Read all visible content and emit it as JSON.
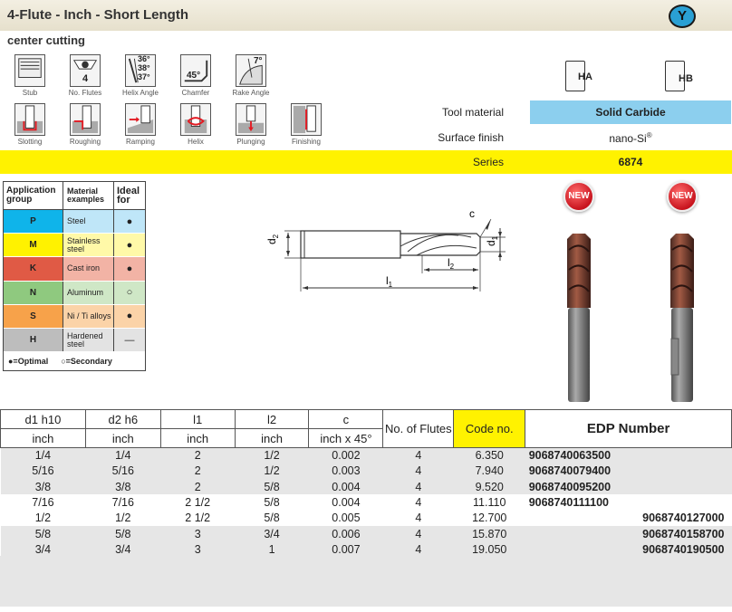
{
  "header": {
    "title": "4-Flute - Inch - Short Length",
    "coating_badge": "Y",
    "subtitle": "center cutting"
  },
  "feature_icons": {
    "row1": [
      {
        "label": "Stub",
        "icon": "stub-icon"
      },
      {
        "label": "No. Flutes",
        "icon": "flutes-icon",
        "value": "4"
      },
      {
        "label": "Helix Angle",
        "icon": "helix-angle-icon",
        "values": [
          "36°",
          "38°",
          "37°"
        ]
      },
      {
        "label": "Chamfer",
        "icon": "chamfer-icon",
        "value": "45°"
      },
      {
        "label": "Rake Angle",
        "icon": "rake-angle-icon",
        "value": "7°"
      }
    ],
    "row2": [
      {
        "label": "Slotting",
        "icon": "slotting-icon"
      },
      {
        "label": "Roughing",
        "icon": "roughing-icon"
      },
      {
        "label": "Ramping",
        "icon": "ramping-icon"
      },
      {
        "label": "Helix",
        "icon": "helix-icon"
      },
      {
        "label": "Plunging",
        "icon": "plunging-icon"
      },
      {
        "label": "Finishing",
        "icon": "finishing-icon"
      }
    ]
  },
  "shank_types": [
    {
      "label": "HA"
    },
    {
      "label": "HB"
    }
  ],
  "properties": {
    "tool_material_label": "Tool material",
    "tool_material_value": "Solid Carbide",
    "surface_finish_label": "Surface finish",
    "surface_finish_value": "nano-Si",
    "surface_finish_mark": "®",
    "series_label": "Series",
    "series_value": "6874"
  },
  "application_table": {
    "headers": [
      "Application group",
      "Material examples",
      "Ideal for"
    ],
    "rows": [
      {
        "group": "P",
        "material": "Steel",
        "ideal": "●",
        "color": "#0fb4ea",
        "tint": "#bfe6f8"
      },
      {
        "group": "M",
        "material": "Stainless steel",
        "ideal": "●",
        "color": "#fff200",
        "tint": "#fff9a8"
      },
      {
        "group": "K",
        "material": "Cast iron",
        "ideal": "●",
        "color": "#e05a45",
        "tint": "#f2b3a5"
      },
      {
        "group": "N",
        "material": "Aluminum",
        "ideal": "○",
        "color": "#8fc97f",
        "tint": "#cfe7c6"
      },
      {
        "group": "S",
        "material": "Ni / Ti alloys",
        "ideal": "●",
        "color": "#f7a24a",
        "tint": "#fbd3a8"
      },
      {
        "group": "H",
        "material": "Hardened steel",
        "ideal": "—",
        "color": "#bdbdbd",
        "tint": "#e3e3e3"
      }
    ],
    "legend_optimal": "●=Optimal",
    "legend_secondary": "○=Secondary"
  },
  "drawing_labels": {
    "c": "c",
    "d1": "d",
    "d1_sub": "1",
    "d2": "d",
    "d2_sub": "2",
    "l1": "l",
    "l1_sub": "1",
    "l2": "l",
    "l2_sub": "2"
  },
  "new_badge": "NEW",
  "data_table": {
    "headers": [
      "d1 h10",
      "d2 h6",
      "l1",
      "l2",
      "c",
      "No. of Flutes",
      "Code no.",
      "EDP Number"
    ],
    "units": [
      "inch",
      "inch",
      "inch",
      "inch",
      "inch x 45°"
    ],
    "rows": [
      {
        "d1": "1/4",
        "d2": "1/4",
        "l1": "2",
        "l2": "1/2",
        "c": "0.002",
        "flutes": "4",
        "code": "6.350",
        "edp": "9068740063500",
        "edp_col": "left"
      },
      {
        "d1": "5/16",
        "d2": "5/16",
        "l1": "2",
        "l2": "1/2",
        "c": "0.003",
        "flutes": "4",
        "code": "7.940",
        "edp": "9068740079400",
        "edp_col": "left"
      },
      {
        "d1": "3/8",
        "d2": "3/8",
        "l1": "2",
        "l2": "5/8",
        "c": "0.004",
        "flutes": "4",
        "code": "9.520",
        "edp": "9068740095200",
        "edp_col": "left"
      },
      {
        "d1": "7/16",
        "d2": "7/16",
        "l1": "2  1/2",
        "l2": "5/8",
        "c": "0.004",
        "flutes": "4",
        "code": "11.110",
        "edp": "9068740111100",
        "edp_col": "left"
      },
      {
        "d1": "1/2",
        "d2": "1/2",
        "l1": "2  1/2",
        "l2": "5/8",
        "c": "0.005",
        "flutes": "4",
        "code": "12.700",
        "edp": "9068740127000",
        "edp_col": "right"
      },
      {
        "d1": "5/8",
        "d2": "5/8",
        "l1": "3",
        "l2": "3/4",
        "c": "0.006",
        "flutes": "4",
        "code": "15.870",
        "edp": "9068740158700",
        "edp_col": "right"
      },
      {
        "d1": "3/4",
        "d2": "3/4",
        "l1": "3",
        "l2": "1",
        "c": "0.007",
        "flutes": "4",
        "code": "19.050",
        "edp": "9068740190500",
        "edp_col": "right"
      }
    ]
  }
}
